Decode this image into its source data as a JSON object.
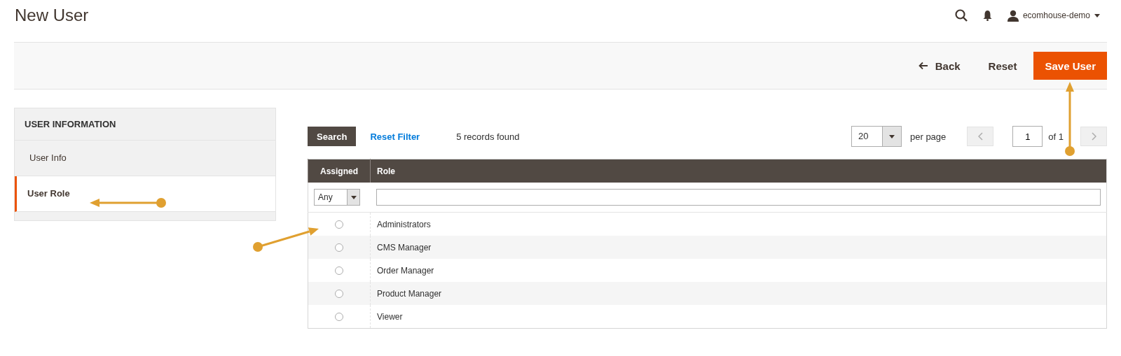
{
  "page_title": "New User",
  "header": {
    "user": "ecomhouse-demo"
  },
  "actions": {
    "back": "Back",
    "reset": "Reset",
    "save": "Save User"
  },
  "sidebar": {
    "title": "USER INFORMATION",
    "items": [
      {
        "label": "User Info",
        "selected": false
      },
      {
        "label": "User Role",
        "selected": true
      }
    ]
  },
  "grid": {
    "search_button": "Search",
    "reset_filter": "Reset Filter",
    "records": "5 records found",
    "per_page_value": "20",
    "per_page_label": "per page",
    "page": "1",
    "of_pages": "of 1",
    "columns": [
      "Assigned",
      "Role"
    ],
    "filter": {
      "assigned": "Any"
    },
    "rows": [
      {
        "role": "Administrators",
        "selected": false
      },
      {
        "role": "CMS Manager",
        "selected": false
      },
      {
        "role": "Order Manager",
        "selected": false
      },
      {
        "role": "Product Manager",
        "selected": false
      },
      {
        "role": "Viewer",
        "selected": false
      }
    ]
  }
}
